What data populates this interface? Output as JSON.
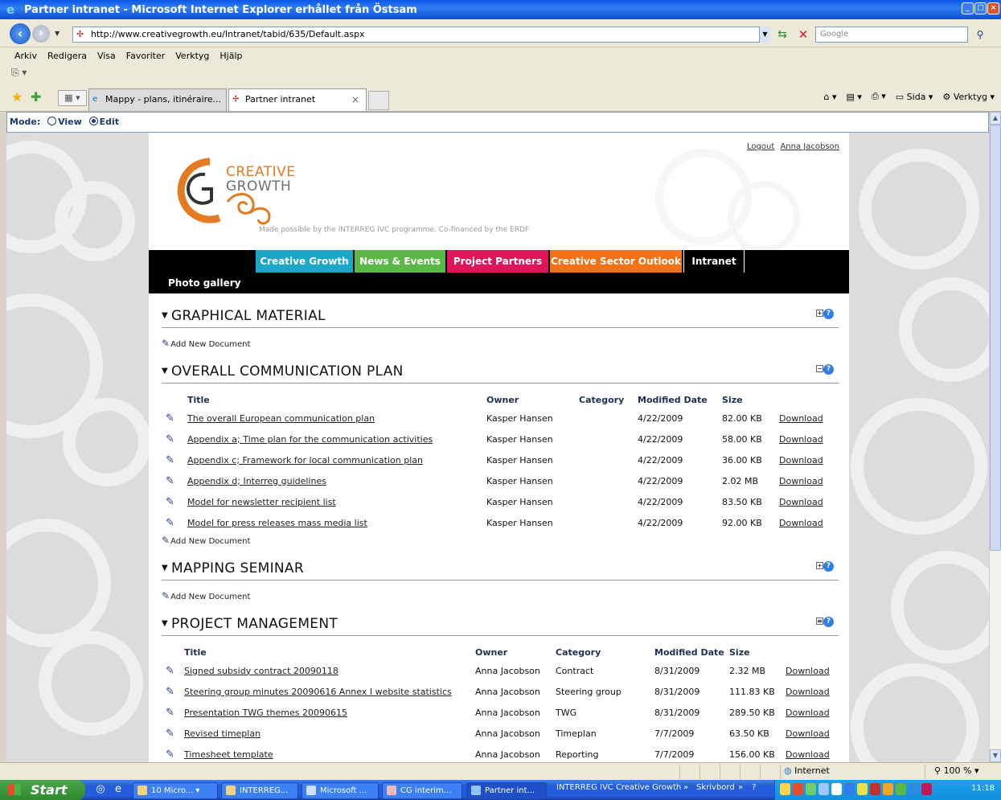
{
  "window": {
    "title": "Partner intranet - Microsoft Internet Explorer erhållet från Östsam"
  },
  "address": {
    "url": "http://www.creativegrowth.eu/Intranet/tabid/635/Default.aspx",
    "search_placeholder": "Google"
  },
  "menu": [
    "Arkiv",
    "Redigera",
    "Visa",
    "Favoriter",
    "Verktyg",
    "Hjälp"
  ],
  "tabs": [
    {
      "label": "Mappy - plans, itinéraire...",
      "active": false
    },
    {
      "label": "Partner intranet",
      "active": true
    }
  ],
  "commandbar": {
    "page_label": "Sida",
    "tools_label": "Verktyg"
  },
  "mode": {
    "label": "Mode:",
    "view": "View",
    "edit": "Edit",
    "selected": "edit"
  },
  "site": {
    "logo_line1": "CREATIVE",
    "logo_line2": "GROWTH",
    "tagline": "Made possible by the INTERREG IVC programme. Co-financed by the ERDF",
    "logout": "Logout",
    "user": "Anna Jacobson",
    "nav": [
      {
        "label": "Creative Growth",
        "color": "#1ba7c7"
      },
      {
        "label": "News & Events",
        "color": "#5bb847"
      },
      {
        "label": "Project Partners",
        "color": "#e0145b"
      },
      {
        "label": "Creative Sector Outlook",
        "color": "#f47216"
      },
      {
        "label": "Intranet",
        "color": "#000000"
      }
    ],
    "subnav": "Photo gallery"
  },
  "sections": {
    "graphical": {
      "title": "GRAPHICAL MATERIAL",
      "add_label": "Add New Document"
    },
    "comm": {
      "title": "OVERALL COMMUNICATION PLAN",
      "add_label": "Add New Document",
      "headers": {
        "title": "Title",
        "owner": "Owner",
        "category": "Category",
        "modified": "Modified Date",
        "size": "Size"
      },
      "rows": [
        {
          "title": "The overall European communication plan",
          "owner": "Kasper Hansen",
          "category": "",
          "date": "4/22/2009",
          "size": "82.00 KB",
          "download": "Download"
        },
        {
          "title": "Appendix a; Time plan for the communication activities",
          "owner": "Kasper Hansen",
          "category": "",
          "date": "4/22/2009",
          "size": "58.00 KB",
          "download": "Download"
        },
        {
          "title": "Appendix c; Framework for local communication plan",
          "owner": "Kasper Hansen",
          "category": "",
          "date": "4/22/2009",
          "size": "36.00 KB",
          "download": "Download"
        },
        {
          "title": "Appendix d; Interreg guidelines",
          "owner": "Kasper Hansen",
          "category": "",
          "date": "4/22/2009",
          "size": "2.02 MB",
          "download": "Download"
        },
        {
          "title": "Model for newsletter recipient list",
          "owner": "Kasper Hansen",
          "category": "",
          "date": "4/22/2009",
          "size": "83.50 KB",
          "download": "Download"
        },
        {
          "title": "Model for press releases mass media list",
          "owner": "Kasper Hansen",
          "category": "",
          "date": "4/22/2009",
          "size": "92.00 KB",
          "download": "Download"
        }
      ]
    },
    "mapping": {
      "title": "MAPPING SEMINAR",
      "add_label": "Add New Document"
    },
    "pm": {
      "title": "PROJECT MANAGEMENT",
      "headers": {
        "title": "Title",
        "owner": "Owner",
        "category": "Category",
        "modified": "Modified Date",
        "size": "Size"
      },
      "rows": [
        {
          "title": "Signed subsidy contract 20090118",
          "owner": "Anna Jacobson",
          "category": "Contract",
          "date": "8/31/2009",
          "size": "2.32 MB",
          "download": "Download"
        },
        {
          "title": "Steering group minutes 20090616 Annex I website statistics",
          "owner": "Anna Jacobson",
          "category": "Steering group",
          "date": "8/31/2009",
          "size": "111.83 KB",
          "download": "Download"
        },
        {
          "title": "Presentation TWG themes 20090615",
          "owner": "Anna Jacobson",
          "category": "TWG",
          "date": "8/31/2009",
          "size": "289.50 KB",
          "download": "Download"
        },
        {
          "title": "Revised timeplan",
          "owner": "Anna Jacobson",
          "category": "Timeplan",
          "date": "7/7/2009",
          "size": "63.50 KB",
          "download": "Download"
        },
        {
          "title": "Timesheet template",
          "owner": "Anna Jacobson",
          "category": "Reporting",
          "date": "7/7/2009",
          "size": "156.00 KB",
          "download": "Download"
        }
      ]
    }
  },
  "statusbar": {
    "zone": "Internet",
    "zoom": "100 %"
  },
  "taskbar": {
    "start": "Start",
    "tasks": [
      {
        "label": "10 Micro..."
      },
      {
        "label": "INTERREG..."
      },
      {
        "label": "Microsoft ..."
      },
      {
        "label": "CG interim..."
      },
      {
        "label": "Partner int..."
      }
    ],
    "toolbar_label": "INTERREG IVC Creative Growth",
    "desktop_label": "Skrivbord",
    "clock": "11:18"
  }
}
